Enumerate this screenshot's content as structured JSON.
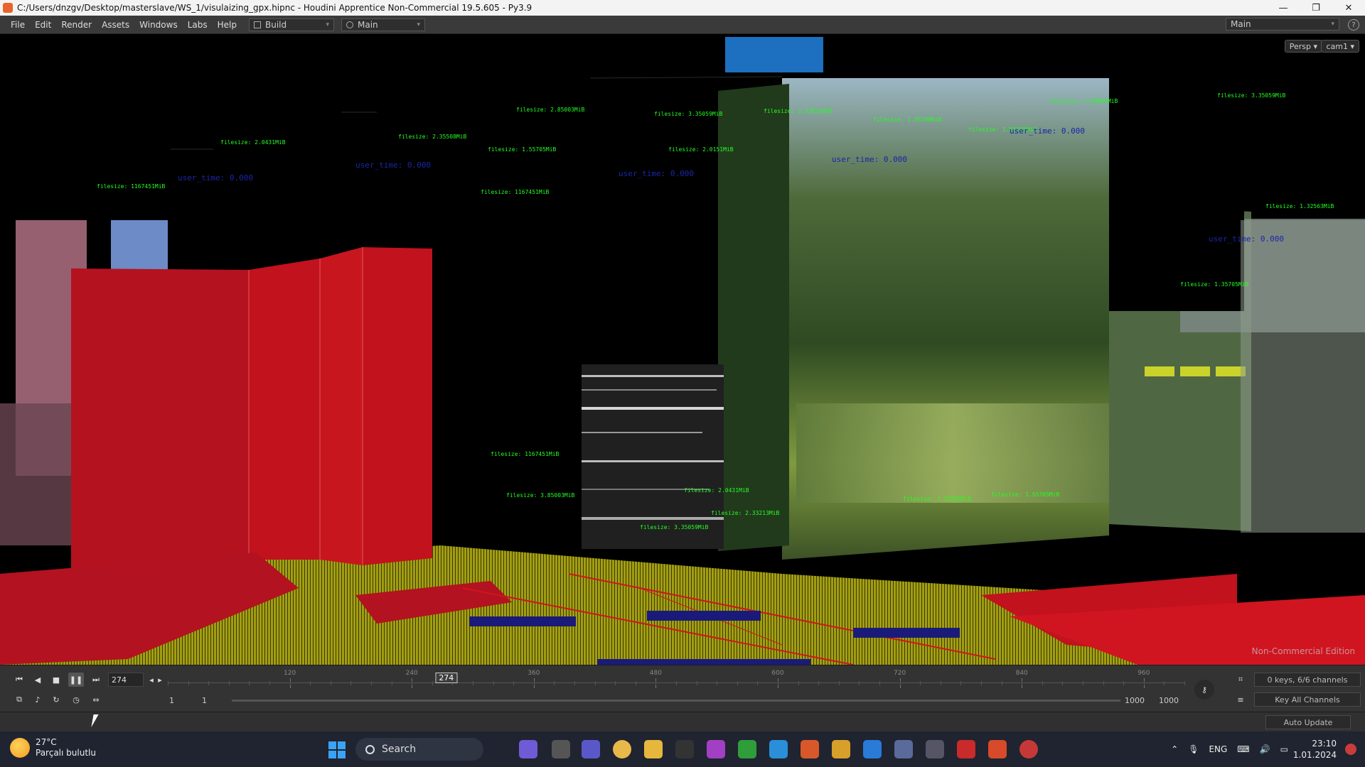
{
  "window": {
    "title": "C:/Users/dnzgv/Desktop/masterslave/WS_1/visulaizing_gpx.hipnc - Houdini Apprentice Non-Commercial 19.5.605 - Py3.9",
    "minimize": "—",
    "maximize": "❐",
    "close": "✕"
  },
  "menu": {
    "items": [
      "File",
      "Edit",
      "Render",
      "Assets",
      "Windows",
      "Labs",
      "Help"
    ],
    "desktop_select": "Build",
    "pane_select": "Main",
    "right_desktop": "Main",
    "help": "?"
  },
  "viewport": {
    "persp_label": "Persp ▾",
    "cam_label": "cam1 ▾",
    "watermark": "Non-Commercial Edition",
    "annotations": [
      {
        "label": "filesize: 2.0431MiB"
      },
      {
        "label": "filesize: 1167451MiB"
      },
      {
        "label": "filesize: 2.35508MiB"
      },
      {
        "label": "filesize: 2.85003MiB"
      },
      {
        "label": "filesize: 1.55705MiB"
      },
      {
        "label": "filesize: 1167451MiB"
      },
      {
        "label": "filesize: 3.35059MiB"
      },
      {
        "label": "filesize: 2.0151MiB"
      },
      {
        "label": "filesize: 3.32051MiB"
      },
      {
        "label": "filesize: 1.35709MiB"
      },
      {
        "label": "filesize: 1.55705MiB"
      },
      {
        "label": "filesize: 3.89809MiB"
      },
      {
        "label": "filesize: 3.35059MiB"
      },
      {
        "label": "filesize: 1.32563MiB"
      },
      {
        "label": "filesize: 1167451MiB"
      },
      {
        "label": "filesize: 1.35705MiB"
      },
      {
        "label": "filesize: 2.0431MiB"
      },
      {
        "label": "filesize: 1.35505MiB"
      },
      {
        "label": "filesize: 1.55705MiB"
      },
      {
        "label": "filesize: 3.85003MiB"
      },
      {
        "label": "filesize: 3.35059MiB"
      },
      {
        "label": "filesize: 2.33213MiB"
      }
    ],
    "blue_labels": [
      "user_time: 0.000",
      "user_time: 0.000",
      "user_time: 0.000",
      "user_time: 0.000",
      "user_time: 0.000",
      "user_time: 0.000"
    ]
  },
  "playbar": {
    "current_frame": "274",
    "frame_marker": "274",
    "ticks": [
      "120",
      "240",
      "360",
      "480",
      "600",
      "720",
      "840",
      "960"
    ],
    "range_start_a": "1",
    "range_start_b": "1",
    "range_end_a": "1000",
    "range_end_b": "1000",
    "keys_label": "0 keys, 6/6 channels",
    "key_all_label": "Key All Channels",
    "auto_update_label": "Auto Update",
    "progress": 0.274
  },
  "taskbar": {
    "temperature": "27°C",
    "weather": "Parçalı bulutlu",
    "search_label": "Search",
    "language": "ENG",
    "time": "23:10",
    "date": "1.01.2024"
  },
  "colors": {
    "red_bars": "#c1121d",
    "yellow_ground": "#a8a30e",
    "annotation_green": "#22ff22",
    "annotation_red": "#ff2a2a",
    "blue_label": "#1a26a8"
  }
}
